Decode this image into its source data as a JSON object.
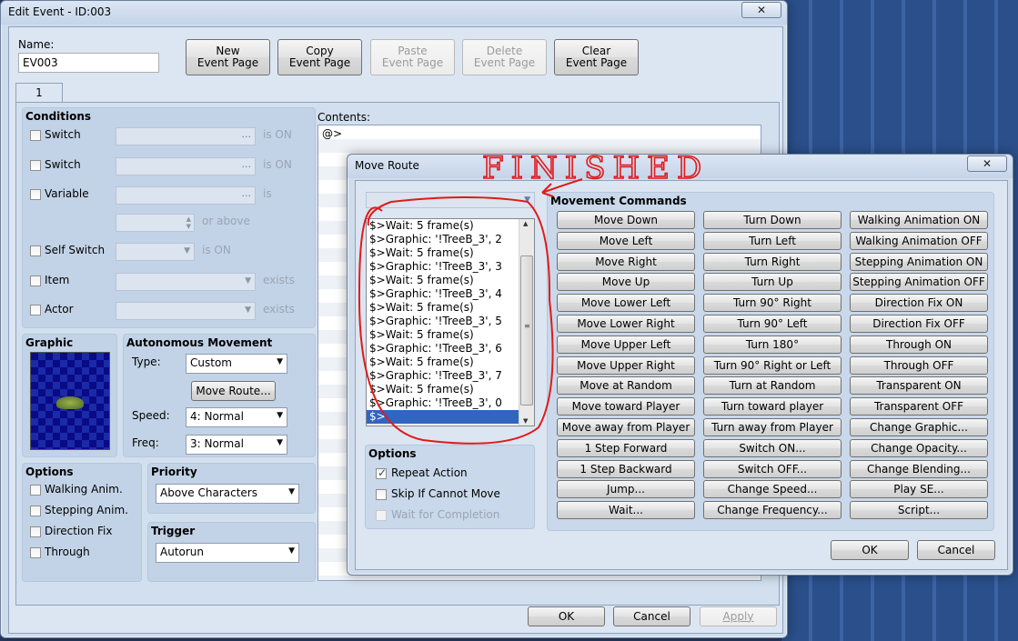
{
  "edit_event": {
    "title": "Edit Event - ID:003",
    "close_glyph": "✕",
    "name_label": "Name:",
    "name_value": "EV003",
    "page_buttons": [
      {
        "label": "New\nEvent Page",
        "enabled": true
      },
      {
        "label": "Copy\nEvent Page",
        "enabled": true
      },
      {
        "label": "Paste\nEvent Page",
        "enabled": false
      },
      {
        "label": "Delete\nEvent Page",
        "enabled": false
      },
      {
        "label": "Clear\nEvent Page",
        "enabled": true
      }
    ],
    "tab_label": "1",
    "conditions": {
      "title": "Conditions",
      "switch1_label": "Switch",
      "switch1_suffix": "is ON",
      "switch2_label": "Switch",
      "switch2_suffix": "is ON",
      "variable_label": "Variable",
      "variable_suffix": "is",
      "variable_or_above": "or above",
      "self_switch_label": "Self Switch",
      "self_switch_suffix": "is ON",
      "item_label": "Item",
      "item_suffix": "exists",
      "actor_label": "Actor",
      "actor_suffix": "exists",
      "field_dots": "..."
    },
    "graphic_title": "Graphic",
    "autonomous": {
      "title": "Autonomous Movement",
      "type_label": "Type:",
      "type_value": "Custom",
      "move_route_button": "Move Route...",
      "speed_label": "Speed:",
      "speed_value": "4: Normal",
      "freq_label": "Freq:",
      "freq_value": "3: Normal"
    },
    "options": {
      "title": "Options",
      "items": [
        {
          "label": "Walking Anim.",
          "checked": false
        },
        {
          "label": "Stepping Anim.",
          "checked": false
        },
        {
          "label": "Direction Fix",
          "checked": false
        },
        {
          "label": "Through",
          "checked": false
        }
      ]
    },
    "priority": {
      "title": "Priority",
      "value": "Above Characters"
    },
    "trigger": {
      "title": "Trigger",
      "value": "Autorun"
    },
    "contents_label": "Contents:",
    "contents_first_line": "@>",
    "ok": "OK",
    "cancel": "Cancel",
    "apply": "Apply"
  },
  "move_route": {
    "title": "Move Route",
    "close_glyph": "✕",
    "target_value": "",
    "commands_list": [
      "$>Wait: 5 frame(s)",
      "$>Graphic: '!TreeB_3', 2",
      "$>Wait: 5 frame(s)",
      "$>Graphic: '!TreeB_3', 3",
      "$>Wait: 5 frame(s)",
      "$>Graphic: '!TreeB_3', 4",
      "$>Wait: 5 frame(s)",
      "$>Graphic: '!TreeB_3', 5",
      "$>Wait: 5 frame(s)",
      "$>Graphic: '!TreeB_3', 6",
      "$>Wait: 5 frame(s)",
      "$>Graphic: '!TreeB_3', 7",
      "$>Wait: 5 frame(s)",
      "$>Graphic: '!TreeB_3', 0",
      "$>"
    ],
    "selected_index": 14,
    "options": {
      "title": "Options",
      "repeat_action": {
        "label": "Repeat Action",
        "checked": true
      },
      "skip_if_cannot_move": {
        "label": "Skip If Cannot Move",
        "checked": false
      },
      "wait_for_completion": {
        "label": "Wait for Completion",
        "checked": false,
        "enabled": false
      }
    },
    "movement_commands_title": "Movement Commands",
    "movement_commands": [
      [
        "Move Down",
        "Turn Down",
        "Walking Animation ON"
      ],
      [
        "Move Left",
        "Turn Left",
        "Walking Animation OFF"
      ],
      [
        "Move Right",
        "Turn Right",
        "Stepping Animation ON"
      ],
      [
        "Move Up",
        "Turn Up",
        "Stepping Animation OFF"
      ],
      [
        "Move Lower Left",
        "Turn 90° Right",
        "Direction Fix ON"
      ],
      [
        "Move Lower Right",
        "Turn 90° Left",
        "Direction Fix OFF"
      ],
      [
        "Move Upper Left",
        "Turn 180°",
        "Through ON"
      ],
      [
        "Move Upper Right",
        "Turn 90° Right or Left",
        "Through OFF"
      ],
      [
        "Move at Random",
        "Turn at Random",
        "Transparent ON"
      ],
      [
        "Move toward Player",
        "Turn toward player",
        "Transparent OFF"
      ],
      [
        "Move away from Player",
        "Turn away from Player",
        "Change Graphic..."
      ],
      [
        "1 Step Forward",
        "Switch ON...",
        "Change Opacity..."
      ],
      [
        "1 Step Backward",
        "Switch OFF...",
        "Change Blending..."
      ],
      [
        "Jump...",
        "Change Speed...",
        "Play SE..."
      ],
      [
        "Wait...",
        "Change Frequency...",
        "Script..."
      ]
    ],
    "ok": "OK",
    "cancel": "Cancel"
  },
  "annotation": {
    "text": "FINISHED",
    "color": "#e01a1a"
  }
}
